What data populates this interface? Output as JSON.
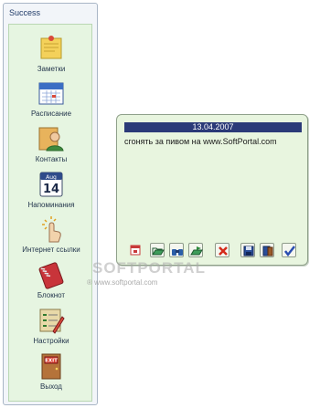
{
  "panel": {
    "title": "Success",
    "items": [
      {
        "label": "Заметки",
        "icon": "sticky-note-icon"
      },
      {
        "label": "Расписание",
        "icon": "calendar-icon"
      },
      {
        "label": "Контакты",
        "icon": "contacts-icon"
      },
      {
        "label": "Напоминания",
        "icon": "reminder-calendar-icon",
        "icon_text": "Aug 14"
      },
      {
        "label": "Интернет ссылки",
        "icon": "web-links-icon"
      },
      {
        "label": "Блокнот",
        "icon": "notebook-icon"
      },
      {
        "label": "Настройки",
        "icon": "settings-icon"
      },
      {
        "label": "Выход",
        "icon": "exit-door-icon",
        "icon_text": "EXIT"
      }
    ]
  },
  "note": {
    "date": "13.04.2007",
    "text": "сгонять за пивом на www.SoftPortal.com",
    "toolbar": [
      {
        "name": "calendar-icon"
      },
      {
        "name": "open-icon"
      },
      {
        "name": "find-icon"
      },
      {
        "name": "send-icon"
      },
      {
        "name": "delete-icon"
      },
      {
        "name": "save-icon"
      },
      {
        "name": "save-as-icon"
      },
      {
        "name": "ok-check-icon"
      }
    ]
  },
  "watermark": {
    "main": "SOFTPORTAL",
    "sub": "® www.softportal.com"
  },
  "colors": {
    "panel_bg": "#f2f5f9",
    "panel_inner_bg": "#e6f5e1",
    "note_bg": "#e8f5df",
    "date_bar": "#2b3a78"
  }
}
